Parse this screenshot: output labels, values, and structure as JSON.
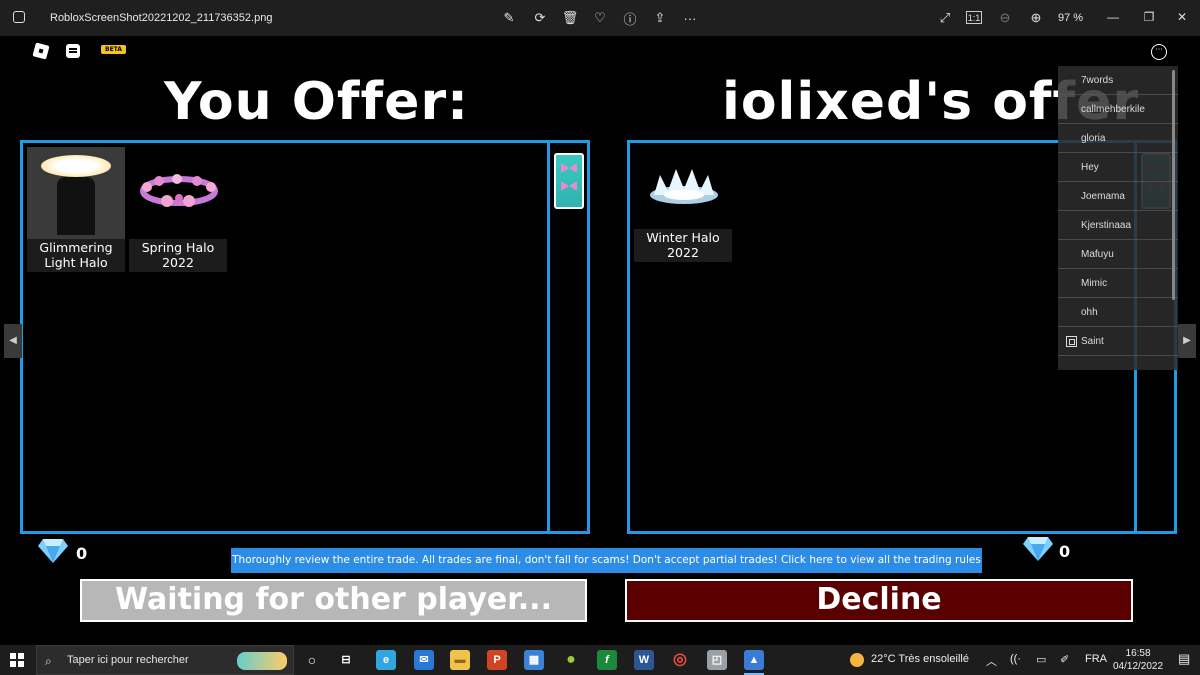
{
  "viewer": {
    "filename": "RobloxScreenShot20221202_211736352.png",
    "zoom": "97 %",
    "tools": {
      "edit": "✎",
      "rotate": "⟳",
      "delete": "🗑",
      "favorite": "♡",
      "info": "ⓘ",
      "share": "⇪",
      "more": "···",
      "fullscreen": "⤢",
      "actual_size": "1:1",
      "zoom_out": "⊖",
      "zoom_in": "⊕"
    },
    "window": {
      "minimize": "—",
      "maximize": "❐",
      "close": "✕"
    }
  },
  "game": {
    "beta_label": "BETA",
    "menu_dots": "···",
    "left_title": "You Offer:",
    "right_title": "iolixed's offer",
    "left_items": [
      {
        "label": "Glimmering Light Halo"
      },
      {
        "label": "Spring Halo 2022"
      }
    ],
    "right_items": [
      {
        "label": "Winter Halo 2022"
      }
    ],
    "left_gems": "0",
    "right_gems": "0",
    "rules_banner": "Thoroughly review the entire trade. All trades are final, don't fall for scams! Don't accept partial trades! Click here to view all the trading rules",
    "waiting_button": "Waiting for other player...",
    "decline_button": "Decline",
    "nav_left": "◀",
    "nav_right": "▶",
    "player_list": [
      "7words",
      "callmehberkile",
      "gloria",
      "Hey",
      "Joemama",
      "Kjerstinaaa",
      "Mafuyu",
      "Mimic",
      "ohh",
      "Saint"
    ]
  },
  "taskbar": {
    "search_icon": "⌕",
    "search_placeholder": "Taper ici pour rechercher",
    "task_view": "⊟",
    "apps": [
      {
        "name": "edge",
        "glyph": "e",
        "color": "#2fa6e0"
      },
      {
        "name": "mail",
        "glyph": "✉",
        "color": "#2a79d6"
      },
      {
        "name": "explorer",
        "glyph": "▬",
        "color": "#f1c34b"
      },
      {
        "name": "powerpoint",
        "glyph": "P",
        "color": "#d04423"
      },
      {
        "name": "store",
        "glyph": "▦",
        "color": "#3b82d6"
      },
      {
        "name": "ball",
        "glyph": "●",
        "color": "#9acb3a"
      },
      {
        "name": "formula",
        "glyph": "f",
        "color": "#1a8a3a"
      },
      {
        "name": "word",
        "glyph": "W",
        "color": "#2b5797"
      },
      {
        "name": "chrome",
        "glyph": "◎",
        "color": "#e64a3b"
      },
      {
        "name": "files",
        "glyph": "◰",
        "color": "#9aa0a6"
      },
      {
        "name": "photos",
        "glyph": "▲",
        "color": "#3a7bd5"
      }
    ],
    "tray": {
      "up_arrow": "︿",
      "network": "((·",
      "battery": "▭",
      "pen": "✐"
    },
    "weather": "22°C  Très ensoleillé",
    "language": "FRA",
    "time": "16:58",
    "date": "04/12/2022",
    "notifications": "▤"
  }
}
